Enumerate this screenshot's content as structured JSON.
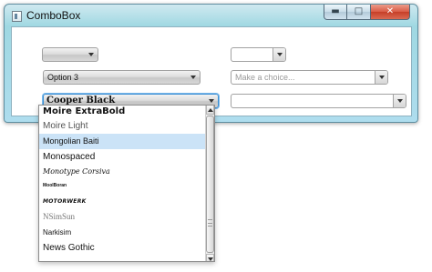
{
  "window": {
    "title": "ComboBox",
    "buttons": {
      "minimize_glyph": "▬",
      "maximize_glyph": "□",
      "close_glyph": "✕"
    },
    "icons": {
      "app": "app-icon",
      "minimize": "minimize-icon",
      "maximize": "maximize-icon",
      "close": "close-icon"
    }
  },
  "combos": {
    "top_left": {
      "value": ""
    },
    "top_right": {
      "value": ""
    },
    "middle_left": {
      "value": "Option 3"
    },
    "middle_right": {
      "placeholder": "Make a choice..."
    },
    "font_combo": {
      "value": "Cooper Black"
    },
    "bottom_right": {
      "value": ""
    }
  },
  "font_list": {
    "items": [
      "Moire ExtraBold",
      "Moire Light",
      "Mongolian Baiti",
      "Monospaced",
      "Monotype Corsiva",
      "MoolBoran",
      "MOTORWERK",
      "NSimSun",
      "Narkisim",
      "News Gothic"
    ],
    "selected": "Mongolian Baiti"
  },
  "colors": {
    "window_frame": "#9fd8e2",
    "selection": "#cbe3f7",
    "focus_ring": "#3b8fd4",
    "close_button": "#d95b45"
  }
}
